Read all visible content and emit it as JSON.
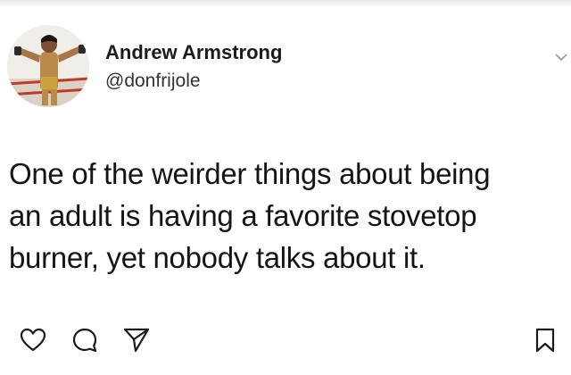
{
  "post": {
    "author": {
      "display_name": "Andrew Armstrong",
      "handle": "@donfrijole",
      "avatar_icon": "avatar-photo-icon"
    },
    "text_lines": [
      "One of the weirder things about being",
      "an adult is having a favorite stovetop",
      "burner, yet nobody talks about it."
    ],
    "actions": {
      "like_icon": "heart-icon",
      "comment_icon": "comment-icon",
      "share_icon": "send-icon",
      "save_icon": "bookmark-icon"
    },
    "menu_icon": "chevron-down-icon"
  },
  "colors": {
    "text": "#141414",
    "handle": "#333333",
    "icon_stroke": "#1a1a1a",
    "background": "#ffffff"
  }
}
